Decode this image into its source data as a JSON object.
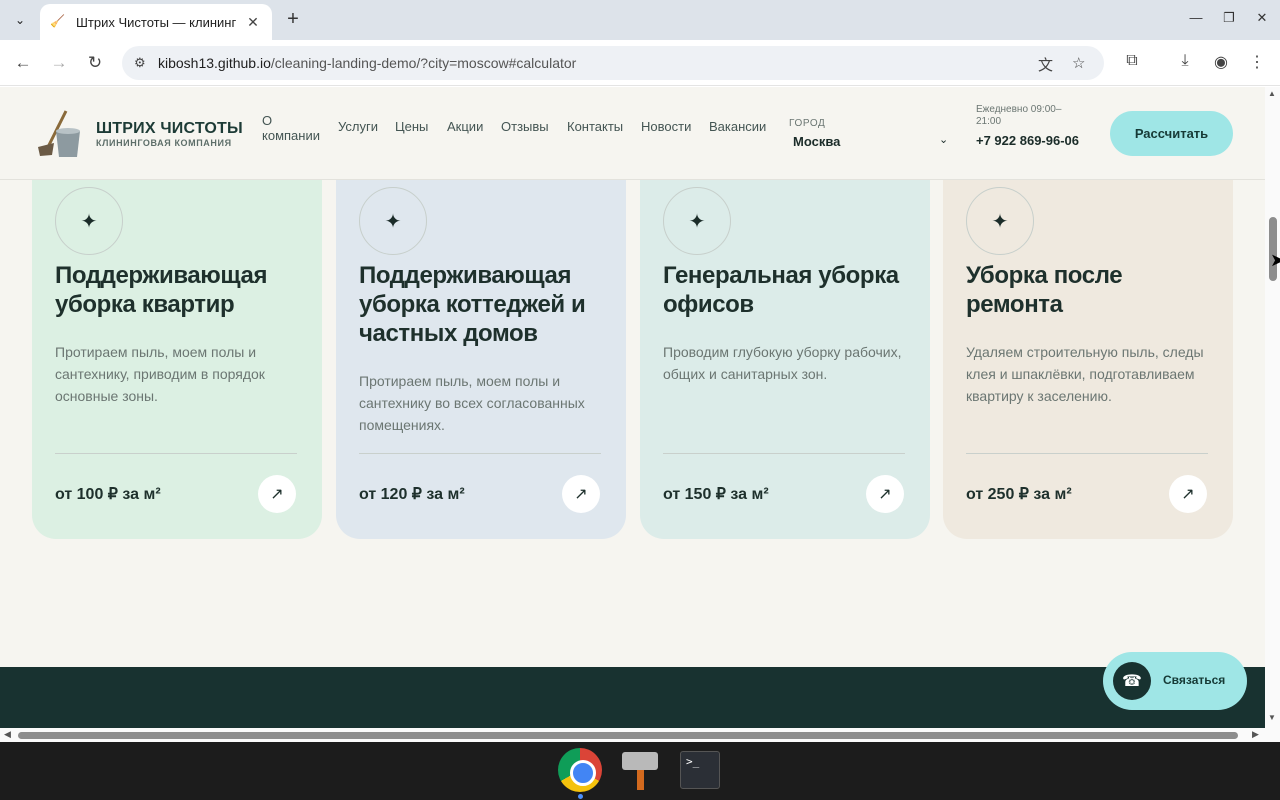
{
  "browser": {
    "tab_title": "Штрих Чистоты — клининг",
    "url_host": "kibosh13.github.io",
    "url_path": "/cleaning-landing-demo/?city=moscow#calculator"
  },
  "header": {
    "brand_name": "ШТРИХ ЧИСТОТЫ",
    "brand_sub": "КЛИНИНГОВАЯ КОМПАНИЯ",
    "nav": [
      "О компании",
      "Услуги",
      "Цены",
      "Акции",
      "Отзывы",
      "Контакты",
      "Новости",
      "Вакансии"
    ],
    "city_label": "ГОРОД",
    "city_value": "Москва",
    "hours": "Ежедневно 09:00–21:00",
    "phone": "+7 922 869-96-06",
    "cta": "Рассчитать"
  },
  "cards": [
    {
      "title": "Поддерживающая уборка квартир",
      "desc": "Протираем пыль, моем полы и сантехнику, приводим в порядок основные зоны.",
      "price": "от 100 ₽ за м²",
      "bg": "#dcf0e3"
    },
    {
      "title": "Поддерживающая уборка коттеджей и частных домов",
      "desc": "Протираем пыль, моем полы и сантехнику во всех согласованных помещениях.",
      "price": "от 120 ₽ за м²",
      "bg": "#dfe7ee"
    },
    {
      "title": "Генеральная уборка офисов",
      "desc": "Проводим глубокую уборку рабочих, общих и санитарных зон.",
      "price": "от 150 ₽ за м²",
      "bg": "#dcece9"
    },
    {
      "title": "Уборка после ремонта",
      "desc": "Удаляем строительную пыль, следы клея и шпаклёвки, подготавливаем квартиру к заселению.",
      "price": "от 250 ₽ за м²",
      "bg": "#efe9df"
    }
  ],
  "card_icon": "✦",
  "card_arrow": "↗",
  "contact_button": "Связаться",
  "colors": {
    "accent": "#9fe6e6",
    "dark": "#183230",
    "page_bg": "#f6f5f0"
  }
}
